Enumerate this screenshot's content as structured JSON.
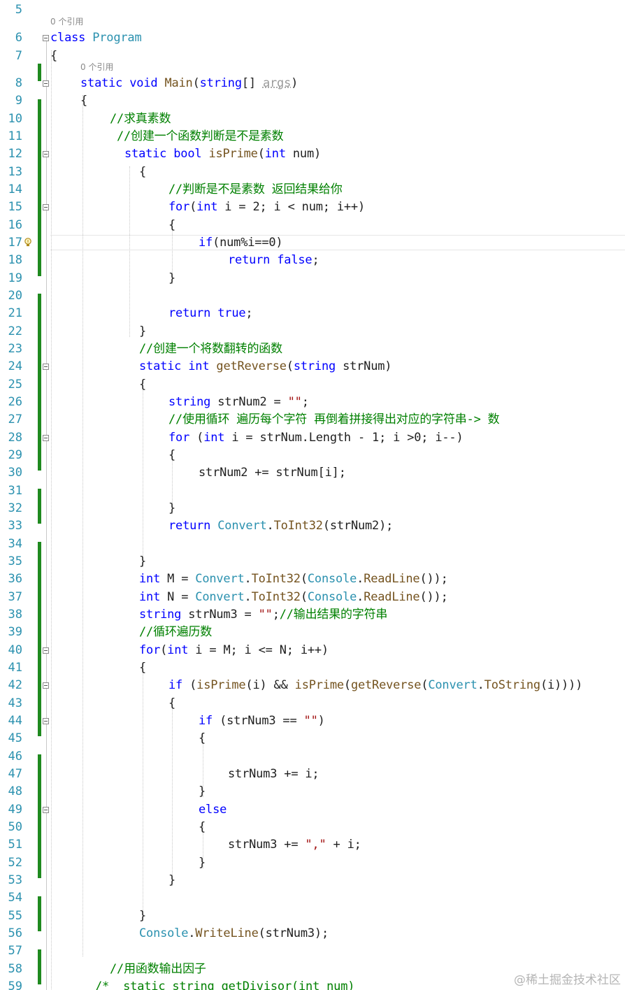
{
  "editor": {
    "codelens": [
      {
        "line": 6,
        "text": "0 个引用"
      },
      {
        "line": 8,
        "text": "0 个引用"
      }
    ],
    "lines": [
      {
        "n": "5",
        "tokens": []
      },
      {
        "n": "6",
        "tokens": [
          {
            "t": "class",
            "c": "kw"
          },
          {
            "t": " ",
            "c": "id"
          },
          {
            "t": "Program",
            "c": "type"
          }
        ]
      },
      {
        "n": "7",
        "tokens": [
          {
            "t": "{",
            "c": "id"
          }
        ]
      },
      {
        "n": "8",
        "tokens": [
          {
            "t": "static",
            "c": "kw"
          },
          {
            "t": " ",
            "c": "id"
          },
          {
            "t": "void",
            "c": "kw"
          },
          {
            "t": " ",
            "c": "id"
          },
          {
            "t": "Main",
            "c": "meth"
          },
          {
            "t": "(",
            "c": "id"
          },
          {
            "t": "string",
            "c": "kw"
          },
          {
            "t": "[] ",
            "c": "id"
          },
          {
            "t": "args",
            "c": "dim"
          },
          {
            "t": ")",
            "c": "id"
          }
        ]
      },
      {
        "n": "9",
        "tokens": [
          {
            "t": "{",
            "c": "id"
          }
        ]
      },
      {
        "n": "10",
        "tokens": [
          {
            "t": "//求真素数",
            "c": "com"
          }
        ]
      },
      {
        "n": "11",
        "tokens": [
          {
            "t": "//创建一个函数判断是不是素数",
            "c": "com"
          }
        ]
      },
      {
        "n": "12",
        "tokens": [
          {
            "t": "static",
            "c": "kw"
          },
          {
            "t": " ",
            "c": "id"
          },
          {
            "t": "bool",
            "c": "kw"
          },
          {
            "t": " ",
            "c": "id"
          },
          {
            "t": "isPrime",
            "c": "meth"
          },
          {
            "t": "(",
            "c": "id"
          },
          {
            "t": "int",
            "c": "kw"
          },
          {
            "t": " num)",
            "c": "id"
          }
        ]
      },
      {
        "n": "13",
        "tokens": [
          {
            "t": "{",
            "c": "id"
          }
        ]
      },
      {
        "n": "14",
        "tokens": [
          {
            "t": "//判断是不是素数 返回结果给你",
            "c": "com"
          }
        ]
      },
      {
        "n": "15",
        "tokens": [
          {
            "t": "for",
            "c": "kw"
          },
          {
            "t": "(",
            "c": "id"
          },
          {
            "t": "int",
            "c": "kw"
          },
          {
            "t": " i = 2; i < num; i++)",
            "c": "id"
          }
        ]
      },
      {
        "n": "16",
        "tokens": [
          {
            "t": "{",
            "c": "id"
          }
        ]
      },
      {
        "n": "17",
        "tokens": [
          {
            "t": "if",
            "c": "kw"
          },
          {
            "t": "(num%i==0)",
            "c": "id"
          }
        ]
      },
      {
        "n": "18",
        "tokens": [
          {
            "t": "return",
            "c": "kw"
          },
          {
            "t": " ",
            "c": "id"
          },
          {
            "t": "false",
            "c": "kw"
          },
          {
            "t": ";",
            "c": "id"
          }
        ]
      },
      {
        "n": "19",
        "tokens": [
          {
            "t": "}",
            "c": "id"
          }
        ]
      },
      {
        "n": "20",
        "tokens": []
      },
      {
        "n": "21",
        "tokens": [
          {
            "t": "return",
            "c": "kw"
          },
          {
            "t": " ",
            "c": "id"
          },
          {
            "t": "true",
            "c": "kw"
          },
          {
            "t": ";",
            "c": "id"
          }
        ]
      },
      {
        "n": "22",
        "tokens": [
          {
            "t": "}",
            "c": "id"
          }
        ]
      },
      {
        "n": "23",
        "tokens": [
          {
            "t": "//创建一个将数翻转的函数",
            "c": "com"
          }
        ]
      },
      {
        "n": "24",
        "tokens": [
          {
            "t": "static",
            "c": "kw"
          },
          {
            "t": " ",
            "c": "id"
          },
          {
            "t": "int",
            "c": "kw"
          },
          {
            "t": " ",
            "c": "id"
          },
          {
            "t": "getReverse",
            "c": "meth"
          },
          {
            "t": "(",
            "c": "id"
          },
          {
            "t": "string",
            "c": "kw"
          },
          {
            "t": " strNum)",
            "c": "id"
          }
        ]
      },
      {
        "n": "25",
        "tokens": [
          {
            "t": "{",
            "c": "id"
          }
        ]
      },
      {
        "n": "26",
        "tokens": [
          {
            "t": "string",
            "c": "kw"
          },
          {
            "t": " strNum2 = ",
            "c": "id"
          },
          {
            "t": "\"\"",
            "c": "str"
          },
          {
            "t": ";",
            "c": "id"
          }
        ]
      },
      {
        "n": "27",
        "tokens": [
          {
            "t": "//使用循环 遍历每个字符 再倒着拼接得出对应的字符串-> 数",
            "c": "com"
          }
        ]
      },
      {
        "n": "28",
        "tokens": [
          {
            "t": "for",
            "c": "kw"
          },
          {
            "t": " (",
            "c": "id"
          },
          {
            "t": "int",
            "c": "kw"
          },
          {
            "t": " i = strNum.Length - 1; i >0; i--)",
            "c": "id"
          }
        ]
      },
      {
        "n": "29",
        "tokens": [
          {
            "t": "{",
            "c": "id"
          }
        ]
      },
      {
        "n": "30",
        "tokens": [
          {
            "t": "strNum2 += strNum[i];",
            "c": "id"
          }
        ]
      },
      {
        "n": "31",
        "tokens": []
      },
      {
        "n": "32",
        "tokens": [
          {
            "t": "}",
            "c": "id"
          }
        ]
      },
      {
        "n": "33",
        "tokens": [
          {
            "t": "return",
            "c": "kw"
          },
          {
            "t": " ",
            "c": "id"
          },
          {
            "t": "Convert",
            "c": "type"
          },
          {
            "t": ".",
            "c": "id"
          },
          {
            "t": "ToInt32",
            "c": "meth"
          },
          {
            "t": "(strNum2);",
            "c": "id"
          }
        ]
      },
      {
        "n": "34",
        "tokens": []
      },
      {
        "n": "35",
        "tokens": [
          {
            "t": "}",
            "c": "id"
          }
        ]
      },
      {
        "n": "36",
        "tokens": [
          {
            "t": "int",
            "c": "kw"
          },
          {
            "t": " M = ",
            "c": "id"
          },
          {
            "t": "Convert",
            "c": "type"
          },
          {
            "t": ".",
            "c": "id"
          },
          {
            "t": "ToInt32",
            "c": "meth"
          },
          {
            "t": "(",
            "c": "id"
          },
          {
            "t": "Console",
            "c": "type"
          },
          {
            "t": ".",
            "c": "id"
          },
          {
            "t": "ReadLine",
            "c": "meth"
          },
          {
            "t": "());",
            "c": "id"
          }
        ]
      },
      {
        "n": "37",
        "tokens": [
          {
            "t": "int",
            "c": "kw"
          },
          {
            "t": " N = ",
            "c": "id"
          },
          {
            "t": "Convert",
            "c": "type"
          },
          {
            "t": ".",
            "c": "id"
          },
          {
            "t": "ToInt32",
            "c": "meth"
          },
          {
            "t": "(",
            "c": "id"
          },
          {
            "t": "Console",
            "c": "type"
          },
          {
            "t": ".",
            "c": "id"
          },
          {
            "t": "ReadLine",
            "c": "meth"
          },
          {
            "t": "());",
            "c": "id"
          }
        ]
      },
      {
        "n": "38",
        "tokens": [
          {
            "t": "string",
            "c": "kw"
          },
          {
            "t": " strNum3 = ",
            "c": "id"
          },
          {
            "t": "\"\"",
            "c": "str"
          },
          {
            "t": ";",
            "c": "id"
          },
          {
            "t": "//输出结果的字符串",
            "c": "com"
          }
        ]
      },
      {
        "n": "39",
        "tokens": [
          {
            "t": "//循环遍历数",
            "c": "com"
          }
        ]
      },
      {
        "n": "40",
        "tokens": [
          {
            "t": "for",
            "c": "kw"
          },
          {
            "t": "(",
            "c": "id"
          },
          {
            "t": "int",
            "c": "kw"
          },
          {
            "t": " i = M; i <= N; i++)",
            "c": "id"
          }
        ]
      },
      {
        "n": "41",
        "tokens": [
          {
            "t": "{",
            "c": "id"
          }
        ]
      },
      {
        "n": "42",
        "tokens": [
          {
            "t": "if",
            "c": "kw"
          },
          {
            "t": " (",
            "c": "id"
          },
          {
            "t": "isPrime",
            "c": "meth"
          },
          {
            "t": "(i) && ",
            "c": "id"
          },
          {
            "t": "isPrime",
            "c": "meth"
          },
          {
            "t": "(",
            "c": "id"
          },
          {
            "t": "getReverse",
            "c": "meth"
          },
          {
            "t": "(",
            "c": "id"
          },
          {
            "t": "Convert",
            "c": "type"
          },
          {
            "t": ".",
            "c": "id"
          },
          {
            "t": "ToString",
            "c": "meth"
          },
          {
            "t": "(i))))",
            "c": "id"
          }
        ]
      },
      {
        "n": "43",
        "tokens": [
          {
            "t": "{",
            "c": "id"
          }
        ]
      },
      {
        "n": "44",
        "tokens": [
          {
            "t": "if",
            "c": "kw"
          },
          {
            "t": " (strNum3 == ",
            "c": "id"
          },
          {
            "t": "\"\"",
            "c": "str"
          },
          {
            "t": ")",
            "c": "id"
          }
        ]
      },
      {
        "n": "45",
        "tokens": [
          {
            "t": "{",
            "c": "id"
          }
        ]
      },
      {
        "n": "46",
        "tokens": []
      },
      {
        "n": "47",
        "tokens": [
          {
            "t": "strNum3 += i;",
            "c": "id"
          }
        ]
      },
      {
        "n": "48",
        "tokens": [
          {
            "t": "}",
            "c": "id"
          }
        ]
      },
      {
        "n": "49",
        "tokens": [
          {
            "t": "else",
            "c": "kw"
          }
        ]
      },
      {
        "n": "50",
        "tokens": [
          {
            "t": "{",
            "c": "id"
          }
        ]
      },
      {
        "n": "51",
        "tokens": [
          {
            "t": "strNum3 += ",
            "c": "id"
          },
          {
            "t": "\",\"",
            "c": "str"
          },
          {
            "t": " + i;",
            "c": "id"
          }
        ]
      },
      {
        "n": "52",
        "tokens": [
          {
            "t": "}",
            "c": "id"
          }
        ]
      },
      {
        "n": "53",
        "tokens": [
          {
            "t": "}",
            "c": "id"
          }
        ]
      },
      {
        "n": "54",
        "tokens": []
      },
      {
        "n": "55",
        "tokens": [
          {
            "t": "}",
            "c": "id"
          }
        ]
      },
      {
        "n": "56",
        "tokens": [
          {
            "t": "Console",
            "c": "type"
          },
          {
            "t": ".",
            "c": "id"
          },
          {
            "t": "WriteLine",
            "c": "meth"
          },
          {
            "t": "(strNum3);",
            "c": "id"
          }
        ]
      },
      {
        "n": "57",
        "tokens": []
      },
      {
        "n": "58",
        "tokens": [
          {
            "t": "//用函数输出因子",
            "c": "com"
          }
        ]
      },
      {
        "n": "59",
        "tokens": [
          {
            "t": "/*  static string getDivisor(int num)",
            "c": "com"
          }
        ]
      }
    ]
  },
  "watermark": "@稀土掘金技术社区",
  "colors": {
    "keyword": "#0000ff",
    "type": "#2b91af",
    "comment": "#008000",
    "string": "#a31515",
    "method": "#74531f",
    "line_number": "#2b91af",
    "change_bar": "#1f8a1f"
  },
  "icons": {
    "lightbulb": "lightbulb-icon",
    "fold": "collapse-icon"
  }
}
